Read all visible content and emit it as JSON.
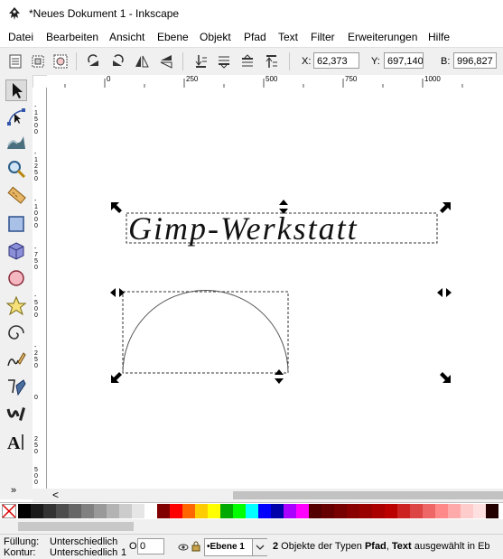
{
  "window": {
    "title": "*Neues Dokument 1 - Inkscape"
  },
  "menu": [
    {
      "label": "Datei"
    },
    {
      "label": "Bearbeiten"
    },
    {
      "label": "Ansicht"
    },
    {
      "label": "Ebene"
    },
    {
      "label": "Objekt"
    },
    {
      "label": "Pfad"
    },
    {
      "label": "Text"
    },
    {
      "label": "Filter"
    },
    {
      "label": "Erweiterungen"
    },
    {
      "label": "Hilfe"
    }
  ],
  "commandbar": {
    "x_label": "X:",
    "x_value": "62,373",
    "y_label": "Y:",
    "y_value": "697,140",
    "w_label": "B:",
    "w_value": "996,827"
  },
  "ruler": {
    "h_ticks": [
      "0",
      "250",
      "500",
      "750",
      "1000"
    ],
    "v_ticks": [
      "-1500",
      "-1250",
      "-1000",
      "-750",
      "-500",
      "-250",
      "0",
      "250",
      "500"
    ]
  },
  "canvas": {
    "text_object": "Gimp-Werkstatt"
  },
  "palette_colors": [
    "#000000",
    "#1a1a1a",
    "#333333",
    "#4d4d4d",
    "#666666",
    "#808080",
    "#999999",
    "#b3b3b3",
    "#cccccc",
    "#e6e6e6",
    "#ffffff",
    "#800000",
    "#ff0000",
    "#ff6600",
    "#ffcc00",
    "#ffff00",
    "#00aa00",
    "#00ff00",
    "#00ffff",
    "#0000ff",
    "#0000aa",
    "#aa00ff",
    "#ff00ff",
    "#550000",
    "#660000",
    "#770000",
    "#880000",
    "#990000",
    "#aa0000",
    "#bb0000",
    "#cc2222",
    "#dd4444",
    "#ee6666",
    "#ff8888",
    "#ffaaaa",
    "#ffcccc",
    "#ffe0e0",
    "#220000"
  ],
  "status": {
    "fill_label": "Füllung:",
    "fill_value": "Unterschiedlich",
    "stroke_label": "Kontur:",
    "stroke_value": "Unterschiedlich",
    "stroke_width": "1",
    "opacity_label": "O:",
    "opacity_value": "0",
    "layer_name": "•Ebene 1",
    "msg_count": "2",
    "msg_mid": " Objekte der Typen ",
    "msg_type1": "Pfad",
    "msg_comma": ", ",
    "msg_type2": "Text",
    "msg_tail": " ausgewählt in Eb"
  },
  "scroll_arrows": {
    "left": "<",
    "more": "»"
  }
}
